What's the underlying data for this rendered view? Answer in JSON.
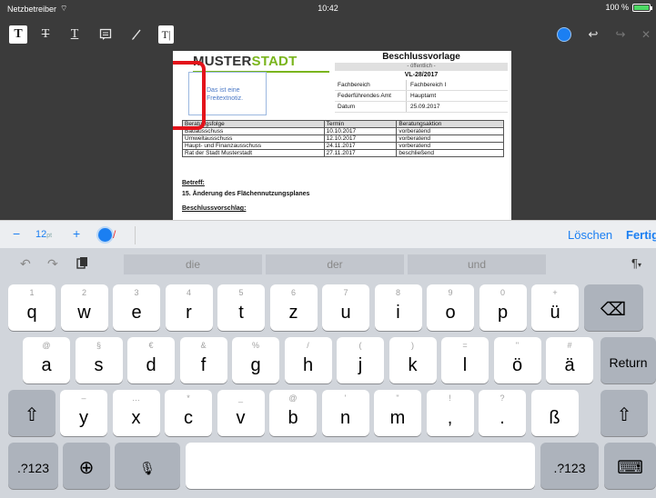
{
  "status": {
    "carrier": "Netzbetreiber",
    "time": "10:42",
    "battery": "100 %",
    "battery_level": 1.0
  },
  "toolbar": {
    "tools": [
      "text-style-icon",
      "strikethrough-icon",
      "underline-icon",
      "note-icon",
      "pen-icon",
      "text-tool-icon"
    ],
    "right": [
      "color-picker",
      "undo-icon",
      "redo-icon",
      "close-icon"
    ],
    "accent": "#1b7ff2"
  },
  "document": {
    "logo_part1": "MUSTER",
    "logo_part2": "STADT",
    "freetext": "Das ist eine Freitextnotiz.",
    "title": "Beschlussvorlage",
    "visibility": "- öffentlich -",
    "number": "VL-28/2017",
    "meta": [
      {
        "key": "Fachbereich",
        "value": "Fachbereich I"
      },
      {
        "key": "Federführendes Amt",
        "value": "Hauptamt"
      },
      {
        "key": "Datum",
        "value": "25.09.2017"
      }
    ],
    "table_headers": [
      "Beratungsfolge",
      "Termin",
      "Beratungsaktion"
    ],
    "table_rows": [
      [
        "Bauausschuss",
        "10.10.2017",
        "vorberatend"
      ],
      [
        "Umweltausschuss",
        "12.10.2017",
        "vorberatend"
      ],
      [
        "Haupt- und Finanzausschuss",
        "24.11.2017",
        "vorberatend"
      ],
      [
        "Rat der Stadt Musterstadt",
        "27.11.2017",
        "beschließend"
      ]
    ],
    "betreff_label": "Betreff:",
    "betreff": "15. Änderung des Flächennutzungsplanes",
    "vorschlag_label": "Beschlussvorschlag:"
  },
  "kb_toolbar": {
    "minus": "−",
    "font_size": "12",
    "font_unit": "pt",
    "plus": "+",
    "delete_label": "Löschen",
    "done_label": "Fertig"
  },
  "predictions": [
    "die",
    "der",
    "und"
  ],
  "keys": {
    "row1": [
      [
        "1",
        "q"
      ],
      [
        "2",
        "w"
      ],
      [
        "3",
        "e"
      ],
      [
        "4",
        "r"
      ],
      [
        "5",
        "t"
      ],
      [
        "6",
        "z"
      ],
      [
        "7",
        "u"
      ],
      [
        "8",
        "i"
      ],
      [
        "9",
        "o"
      ],
      [
        "0",
        "p"
      ],
      [
        "+",
        "ü"
      ]
    ],
    "row2": [
      [
        "@",
        "a"
      ],
      [
        "§",
        "s"
      ],
      [
        "€",
        "d"
      ],
      [
        "&",
        "f"
      ],
      [
        "%",
        "g"
      ],
      [
        "/",
        "h"
      ],
      [
        "(",
        "j"
      ],
      [
        ")",
        "k"
      ],
      [
        "=",
        "l"
      ],
      [
        "\"",
        "ö"
      ],
      [
        "#",
        "ä"
      ]
    ],
    "row3": [
      [
        "–",
        "y"
      ],
      [
        "…",
        "x"
      ],
      [
        "*",
        "c"
      ],
      [
        "_",
        "v"
      ],
      [
        "@",
        "b"
      ],
      [
        "'",
        "n"
      ],
      [
        "\"",
        "m"
      ],
      [
        "!",
        ","
      ],
      [
        "?",
        "."
      ],
      [
        "",
        "ß"
      ]
    ],
    "return_label": "Return",
    "numbers_label": ".?123"
  }
}
